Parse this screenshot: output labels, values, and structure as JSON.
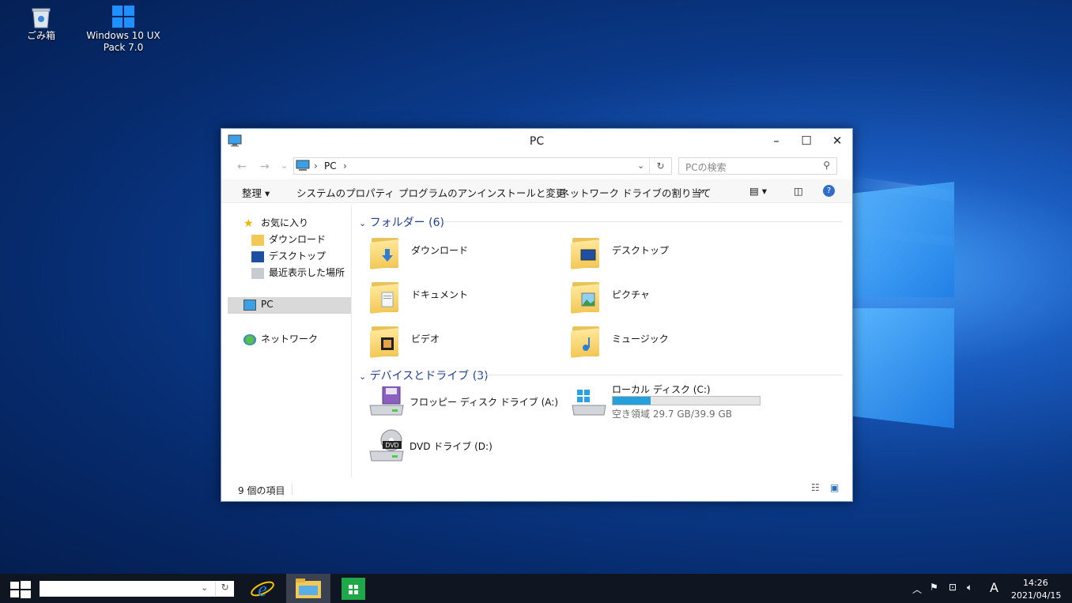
{
  "desktop": {
    "icons": [
      {
        "label": "ごみ箱"
      },
      {
        "label_line1": "Windows 10 UX",
        "label_line2": "Pack 7.0"
      }
    ]
  },
  "window": {
    "title": "PC",
    "nav": {
      "back": "←",
      "forward": "→",
      "down": "⌄"
    },
    "address": {
      "crumb": "PC",
      "sep": "›"
    },
    "search_placeholder": "PCの検索",
    "commands": [
      "整理 ▾",
      "システムのプロパティ",
      "プログラムのアンインストールと変更",
      "ネットワーク ドライブの割り当て",
      "»"
    ],
    "navpane": {
      "favorites": "お気に入り",
      "downloads": "ダウンロード",
      "desktop": "デスクトップ",
      "recent": "最近表示した場所",
      "pc": "PC",
      "network": "ネットワーク"
    },
    "groups": {
      "folders_header": "フォルダー (6)",
      "drives_header": "デバイスとドライブ (3)"
    },
    "folders": [
      "ダウンロード",
      "デスクトップ",
      "ドキュメント",
      "ピクチャ",
      "ビデオ",
      "ミュージック"
    ],
    "drives": {
      "floppy": "フロッピー ディスク ドライブ (A:)",
      "local": "ローカル ディスク (C:)",
      "local_free": "空き領域 29.7 GB/39.9 GB",
      "local_used_fraction": 0.256,
      "dvd": "DVD ドライブ (D:)",
      "dvd_badge": "DVD"
    },
    "status": "9 個の項目"
  },
  "taskbar": {
    "clock_time": "14:26",
    "clock_date": "2021/04/15",
    "ime": "A"
  }
}
